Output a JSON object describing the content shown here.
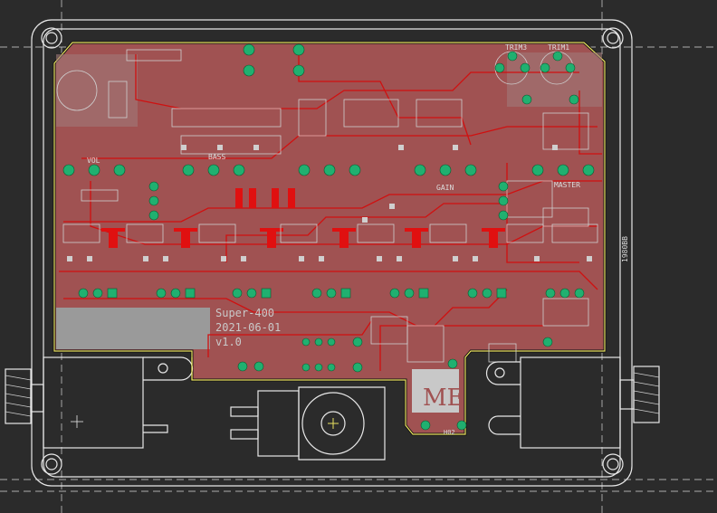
{
  "colors": {
    "background": "#2b2b2b",
    "copper_pour": "#a05252",
    "trace": "#d01010",
    "pad": "#20b070",
    "silkscreen": "#e8e8e8",
    "board_edge": "#e8e060",
    "keepout": "#9a9a9a"
  },
  "board": {
    "project_name": "Super-400",
    "date": "2021-06-01",
    "version": "v1.0",
    "side_label": "1980BB",
    "logo_text": "ME"
  },
  "labels": {
    "vol": "VOL",
    "master": "MASTER",
    "trim_left": "TRIM3",
    "trim_right": "TRIM1",
    "bass": "BASS",
    "gain": "GAIN",
    "connector": "H02"
  }
}
